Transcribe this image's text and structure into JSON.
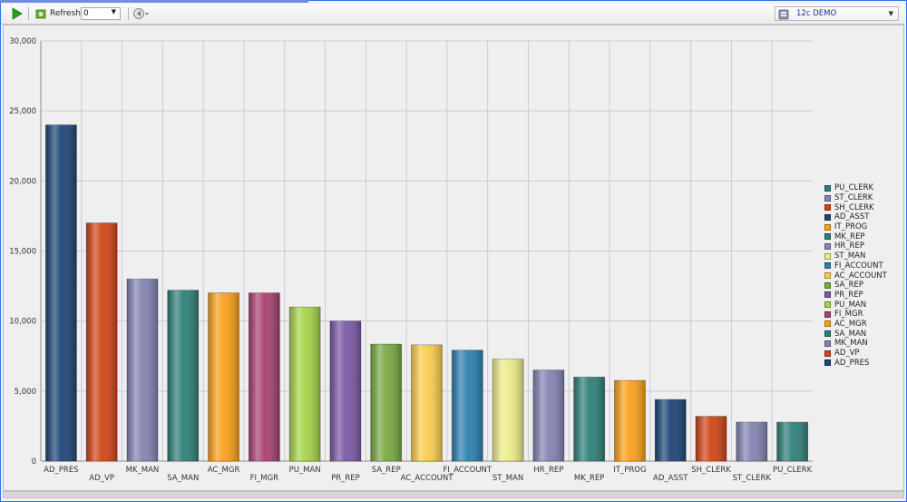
{
  "toolbar": {
    "refresh_label": "Refresh:",
    "refresh_value": "0",
    "connection": "12c DEMO"
  },
  "colors": {
    "PU_CLERK": "#2e7f78",
    "ST_CLERK": "#8383b2",
    "SH_CLERK": "#cf4517",
    "AD_ASST": "#1d4577",
    "IT_PROG": "#f8a01a",
    "MK_REP": "#2e7f78",
    "HR_REP": "#8383b2",
    "ST_MAN": "#ecec8c",
    "FI_ACCOUNT": "#2c7fb0",
    "AC_ACCOUNT": "#f9cd4e",
    "SA_REP": "#79a844",
    "PR_REP": "#7a58a6",
    "PU_MAN": "#a6d34a",
    "FI_MGR": "#a8426f",
    "AC_MGR": "#f8a01a",
    "SA_MAN": "#2e7f78",
    "MK_MAN": "#8383b2",
    "AD_VP": "#cf4517",
    "AD_PRES": "#1d4577"
  },
  "chart_data": {
    "type": "bar",
    "categories": [
      "AD_PRES",
      "AD_VP",
      "MK_MAN",
      "SA_MAN",
      "AC_MGR",
      "FI_MGR",
      "PU_MAN",
      "PR_REP",
      "SA_REP",
      "AC_ACCOUNT",
      "FI_ACCOUNT",
      "ST_MAN",
      "HR_REP",
      "MK_REP",
      "IT_PROG",
      "AD_ASST",
      "SH_CLERK",
      "ST_CLERK",
      "PU_CLERK"
    ],
    "values": [
      24000,
      17000,
      13000,
      12200,
      12008,
      12008,
      11000,
      10000,
      8350,
      8300,
      7920,
      7280,
      6500,
      6000,
      5760,
      4400,
      3200,
      2785,
      2780
    ],
    "ylim": [
      0,
      30000
    ],
    "yticks": [
      0,
      5000,
      10000,
      15000,
      20000,
      25000,
      30000
    ],
    "ytick_labels": [
      "0",
      "5,000",
      "10,000",
      "15,000",
      "20,000",
      "25,000",
      "30,000"
    ],
    "grid": true,
    "legend_placement": "right",
    "legend": [
      "PU_CLERK",
      "ST_CLERK",
      "SH_CLERK",
      "AD_ASST",
      "IT_PROG",
      "MK_REP",
      "HR_REP",
      "ST_MAN",
      "FI_ACCOUNT",
      "AC_ACCOUNT",
      "SA_REP",
      "PR_REP",
      "PU_MAN",
      "FI_MGR",
      "AC_MGR",
      "SA_MAN",
      "MK_MAN",
      "AD_VP",
      "AD_PRES"
    ]
  }
}
